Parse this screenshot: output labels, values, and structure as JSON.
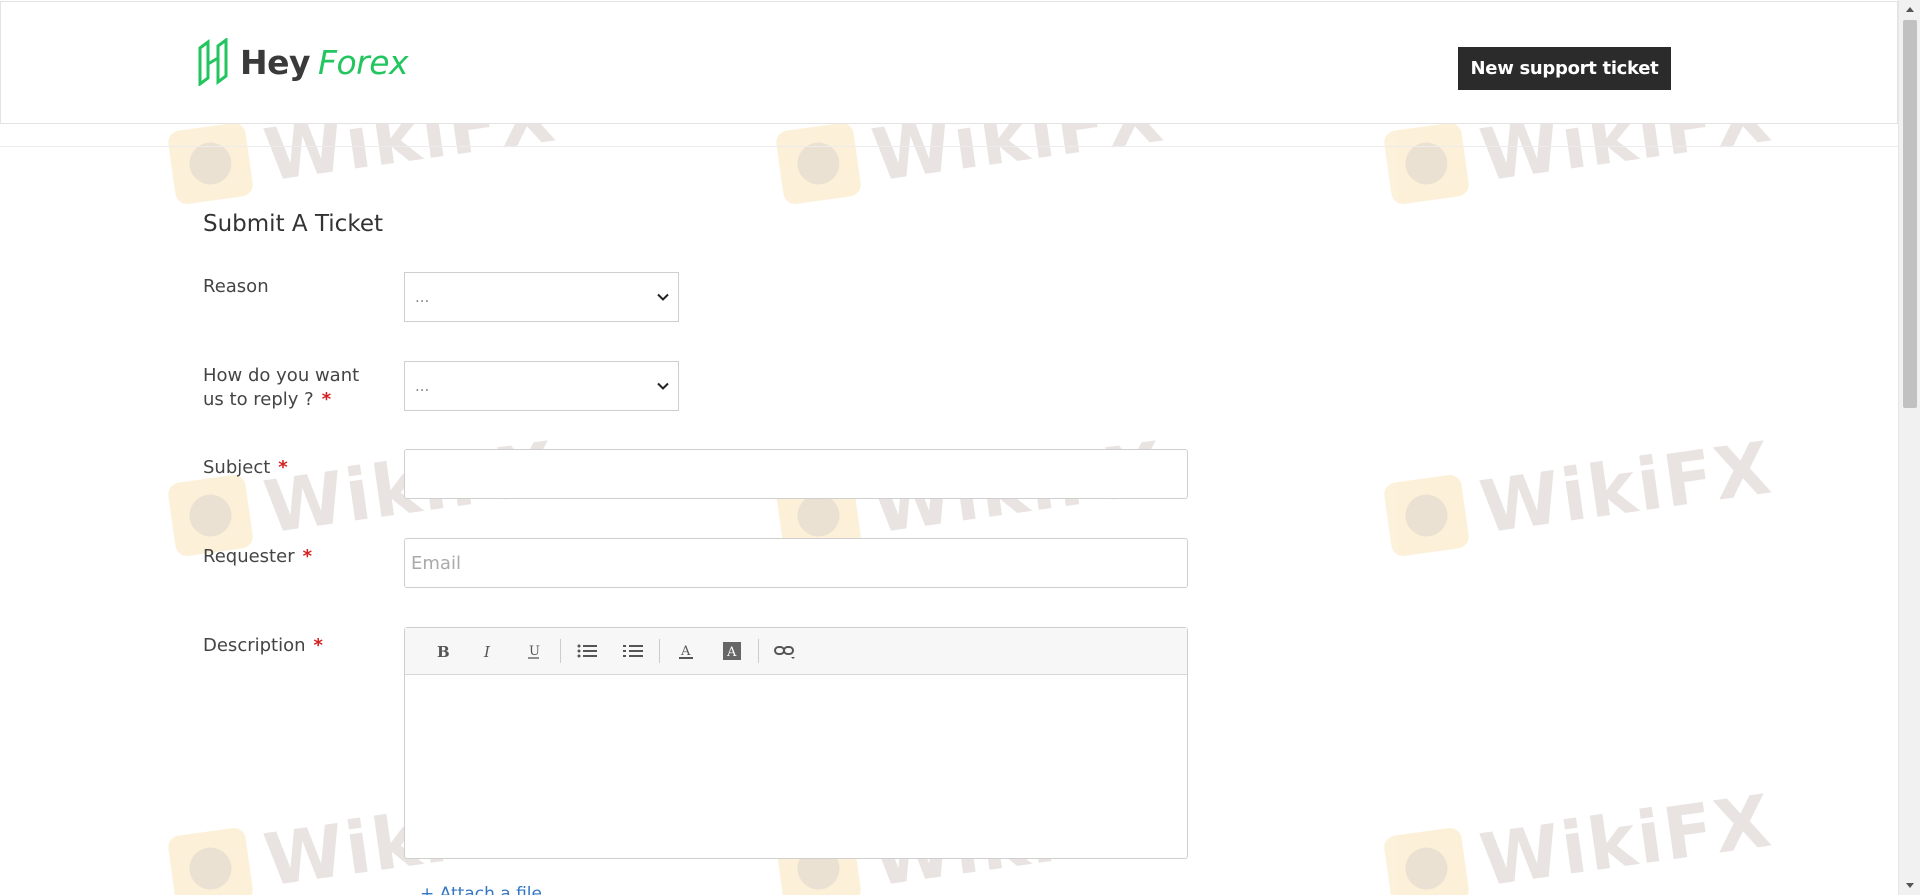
{
  "header": {
    "logo_hey": "Hey",
    "logo_forex": "Forex",
    "new_ticket_label": "New support ticket"
  },
  "watermark": {
    "text": "WikiFX"
  },
  "form": {
    "title": "Submit A Ticket",
    "reason": {
      "label": "Reason",
      "value": "..."
    },
    "reply": {
      "label": "How do you want us to reply ?",
      "value": "..."
    },
    "subject": {
      "label": "Subject",
      "value": ""
    },
    "requester": {
      "label": "Requester",
      "placeholder": "Email"
    },
    "description": {
      "label": "Description"
    },
    "attach_label": "+ Attach a file"
  },
  "editor_toolbar": [
    "bold-icon",
    "italic-icon",
    "underline-icon",
    "bulleted-list-icon",
    "numbered-list-icon",
    "text-color-icon",
    "background-color-icon",
    "link-icon"
  ],
  "colors": {
    "brand_green": "#22c55e",
    "button_dark": "#2b2b2b",
    "required": "#d31f1f",
    "link_blue": "#3577c5"
  }
}
